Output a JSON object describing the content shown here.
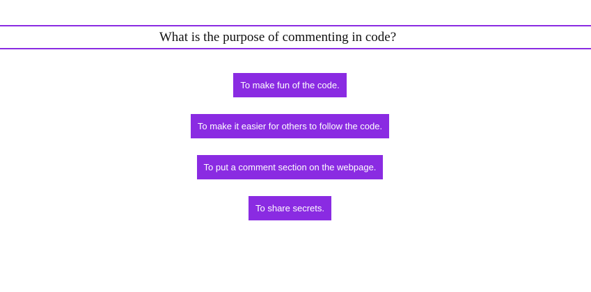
{
  "question": {
    "text": "What is the purpose of commenting in code?"
  },
  "answers": [
    {
      "label": "To make fun of the code."
    },
    {
      "label": "To make it easier for others to follow the code."
    },
    {
      "label": "To put a comment section on the webpage."
    },
    {
      "label": "To share secrets."
    }
  ],
  "colors": {
    "accent": "#8a2be2",
    "button_text": "#ffffff",
    "question_text": "#111111",
    "background": "#ffffff"
  }
}
